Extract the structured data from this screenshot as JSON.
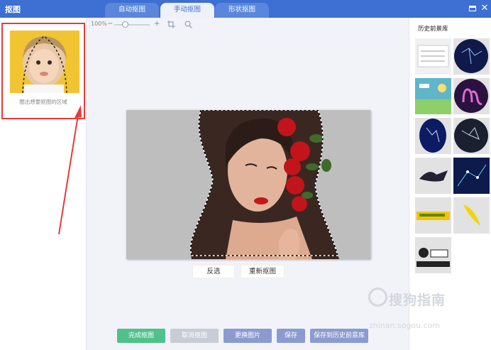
{
  "app": {
    "title": "抠图"
  },
  "tabs": [
    {
      "label": "自动抠图",
      "active": false
    },
    {
      "label": "手动抠图",
      "active": true
    },
    {
      "label": "形状抠图",
      "active": false
    }
  ],
  "left_panel": {
    "caption": "圈出想要抠图的区域"
  },
  "toolbar": {
    "zoom_level": "100%",
    "zoom_minus": "−",
    "zoom_plus": "+",
    "zoom_fraction": 0.3
  },
  "canvas_actions": {
    "invert_label": "反选",
    "reselect_label": "重新抠图"
  },
  "bottom_actions": {
    "done_label": "完成抠图",
    "cancel_label": "取消抠图",
    "change_image_label": "更换图片",
    "save_label": "保存",
    "save_history_label": "保存到历史前景库"
  },
  "right_panel": {
    "title": "历史前景库",
    "items": [
      {
        "name": "history-item-1",
        "desc": "document-screenshot"
      },
      {
        "name": "history-item-2",
        "desc": "blue-constellation"
      },
      {
        "name": "history-item-3",
        "desc": "game-screenshot"
      },
      {
        "name": "history-item-4",
        "desc": "purple-zodiac"
      },
      {
        "name": "history-item-5",
        "desc": "blue-constellation-oval"
      },
      {
        "name": "history-item-6",
        "desc": "constellation-dark"
      },
      {
        "name": "history-item-7",
        "desc": "dark-shape"
      },
      {
        "name": "history-item-8",
        "desc": "constellation-grid"
      },
      {
        "name": "history-item-9",
        "desc": "yellow-banner"
      },
      {
        "name": "history-item-10",
        "desc": "yellow-leaf"
      },
      {
        "name": "history-item-11",
        "desc": "logo-sticker"
      }
    ]
  },
  "watermark": {
    "text": "搜狗指南",
    "url": "zhinan.sogou.com"
  },
  "colors": {
    "titlebar": "#3e6fd2",
    "accent_red": "#e43b3b",
    "done_button": "#4fc18b",
    "disabled_button": "#c8ccd5",
    "blue_button": "#8b9bd0"
  }
}
